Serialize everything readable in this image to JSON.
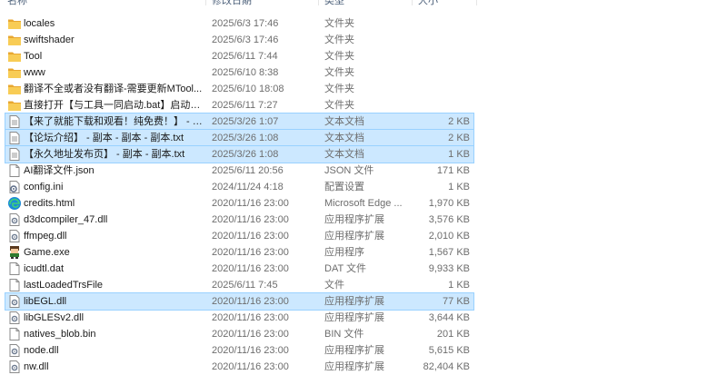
{
  "columns": {
    "name": "名称",
    "date": "修改日期",
    "type": "类型",
    "size": "大小"
  },
  "colors": {
    "selection": "#cce8ff",
    "selection_border": "#99d1ff",
    "folder": "#f5c044"
  },
  "files": [
    {
      "name": "locales",
      "date": "2025/6/3 17:46",
      "type": "文件夹",
      "size": "",
      "icon": "folder-icon",
      "selected": false
    },
    {
      "name": "swiftshader",
      "date": "2025/6/3 17:46",
      "type": "文件夹",
      "size": "",
      "icon": "folder-icon",
      "selected": false
    },
    {
      "name": "Tool",
      "date": "2025/6/11 7:44",
      "type": "文件夹",
      "size": "",
      "icon": "folder-icon",
      "selected": false
    },
    {
      "name": "www",
      "date": "2025/6/10 8:38",
      "type": "文件夹",
      "size": "",
      "icon": "folder-icon",
      "selected": false
    },
    {
      "name": "翻译不全或者没有翻译-需要更新MTool...",
      "date": "2025/6/10 18:08",
      "type": "文件夹",
      "size": "",
      "icon": "folder-icon",
      "selected": false
    },
    {
      "name": "直接打开【与工具一同启动.bat】启动机翻",
      "date": "2025/6/11 7:27",
      "type": "文件夹",
      "size": "",
      "icon": "folder-icon",
      "selected": false
    },
    {
      "name": "【来了就能下载和观看！纯免费！】 - 副...",
      "date": "2025/3/26 1:07",
      "type": "文本文档",
      "size": "2 KB",
      "icon": "text-file-icon",
      "selected": true
    },
    {
      "name": "【论坛介绍】 - 副本 - 副本 - 副本.txt",
      "date": "2025/3/26 1:08",
      "type": "文本文档",
      "size": "2 KB",
      "icon": "text-file-icon",
      "selected": true
    },
    {
      "name": "【永久地址发布页】 - 副本 - 副本.txt",
      "date": "2025/3/26 1:08",
      "type": "文本文档",
      "size": "1 KB",
      "icon": "text-file-icon",
      "selected": true
    },
    {
      "name": "AI翻译文件.json",
      "date": "2025/6/11 20:56",
      "type": "JSON 文件",
      "size": "171 KB",
      "icon": "json-file-icon",
      "selected": false
    },
    {
      "name": "config.ini",
      "date": "2024/11/24 4:18",
      "type": "配置设置",
      "size": "1 KB",
      "icon": "settings-file-icon",
      "selected": false
    },
    {
      "name": "credits.html",
      "date": "2020/11/16 23:00",
      "type": "Microsoft Edge ...",
      "size": "1,970 KB",
      "icon": "edge-icon",
      "selected": false
    },
    {
      "name": "d3dcompiler_47.dll",
      "date": "2020/11/16 23:00",
      "type": "应用程序扩展",
      "size": "3,576 KB",
      "icon": "dll-icon",
      "selected": false
    },
    {
      "name": "ffmpeg.dll",
      "date": "2020/11/16 23:00",
      "type": "应用程序扩展",
      "size": "2,010 KB",
      "icon": "dll-icon",
      "selected": false
    },
    {
      "name": "Game.exe",
      "date": "2020/11/16 23:00",
      "type": "应用程序",
      "size": "1,567 KB",
      "icon": "game-exe-icon",
      "selected": false
    },
    {
      "name": "icudtl.dat",
      "date": "2020/11/16 23:00",
      "type": "DAT 文件",
      "size": "9,933 KB",
      "icon": "blank-file-icon",
      "selected": false
    },
    {
      "name": "lastLoadedTrsFile",
      "date": "2025/6/11 7:45",
      "type": "文件",
      "size": "1 KB",
      "icon": "blank-file-icon",
      "selected": false
    },
    {
      "name": "libEGL.dll",
      "date": "2020/11/16 23:00",
      "type": "应用程序扩展",
      "size": "77 KB",
      "icon": "dll-icon",
      "selected": true
    },
    {
      "name": "libGLESv2.dll",
      "date": "2020/11/16 23:00",
      "type": "应用程序扩展",
      "size": "3,644 KB",
      "icon": "dll-icon",
      "selected": false
    },
    {
      "name": "natives_blob.bin",
      "date": "2020/11/16 23:00",
      "type": "BIN 文件",
      "size": "201 KB",
      "icon": "blank-file-icon",
      "selected": false
    },
    {
      "name": "node.dll",
      "date": "2020/11/16 23:00",
      "type": "应用程序扩展",
      "size": "5,615 KB",
      "icon": "dll-icon",
      "selected": false
    },
    {
      "name": "nw.dll",
      "date": "2020/11/16 23:00",
      "type": "应用程序扩展",
      "size": "82,404 KB",
      "icon": "dll-icon",
      "selected": false
    }
  ]
}
